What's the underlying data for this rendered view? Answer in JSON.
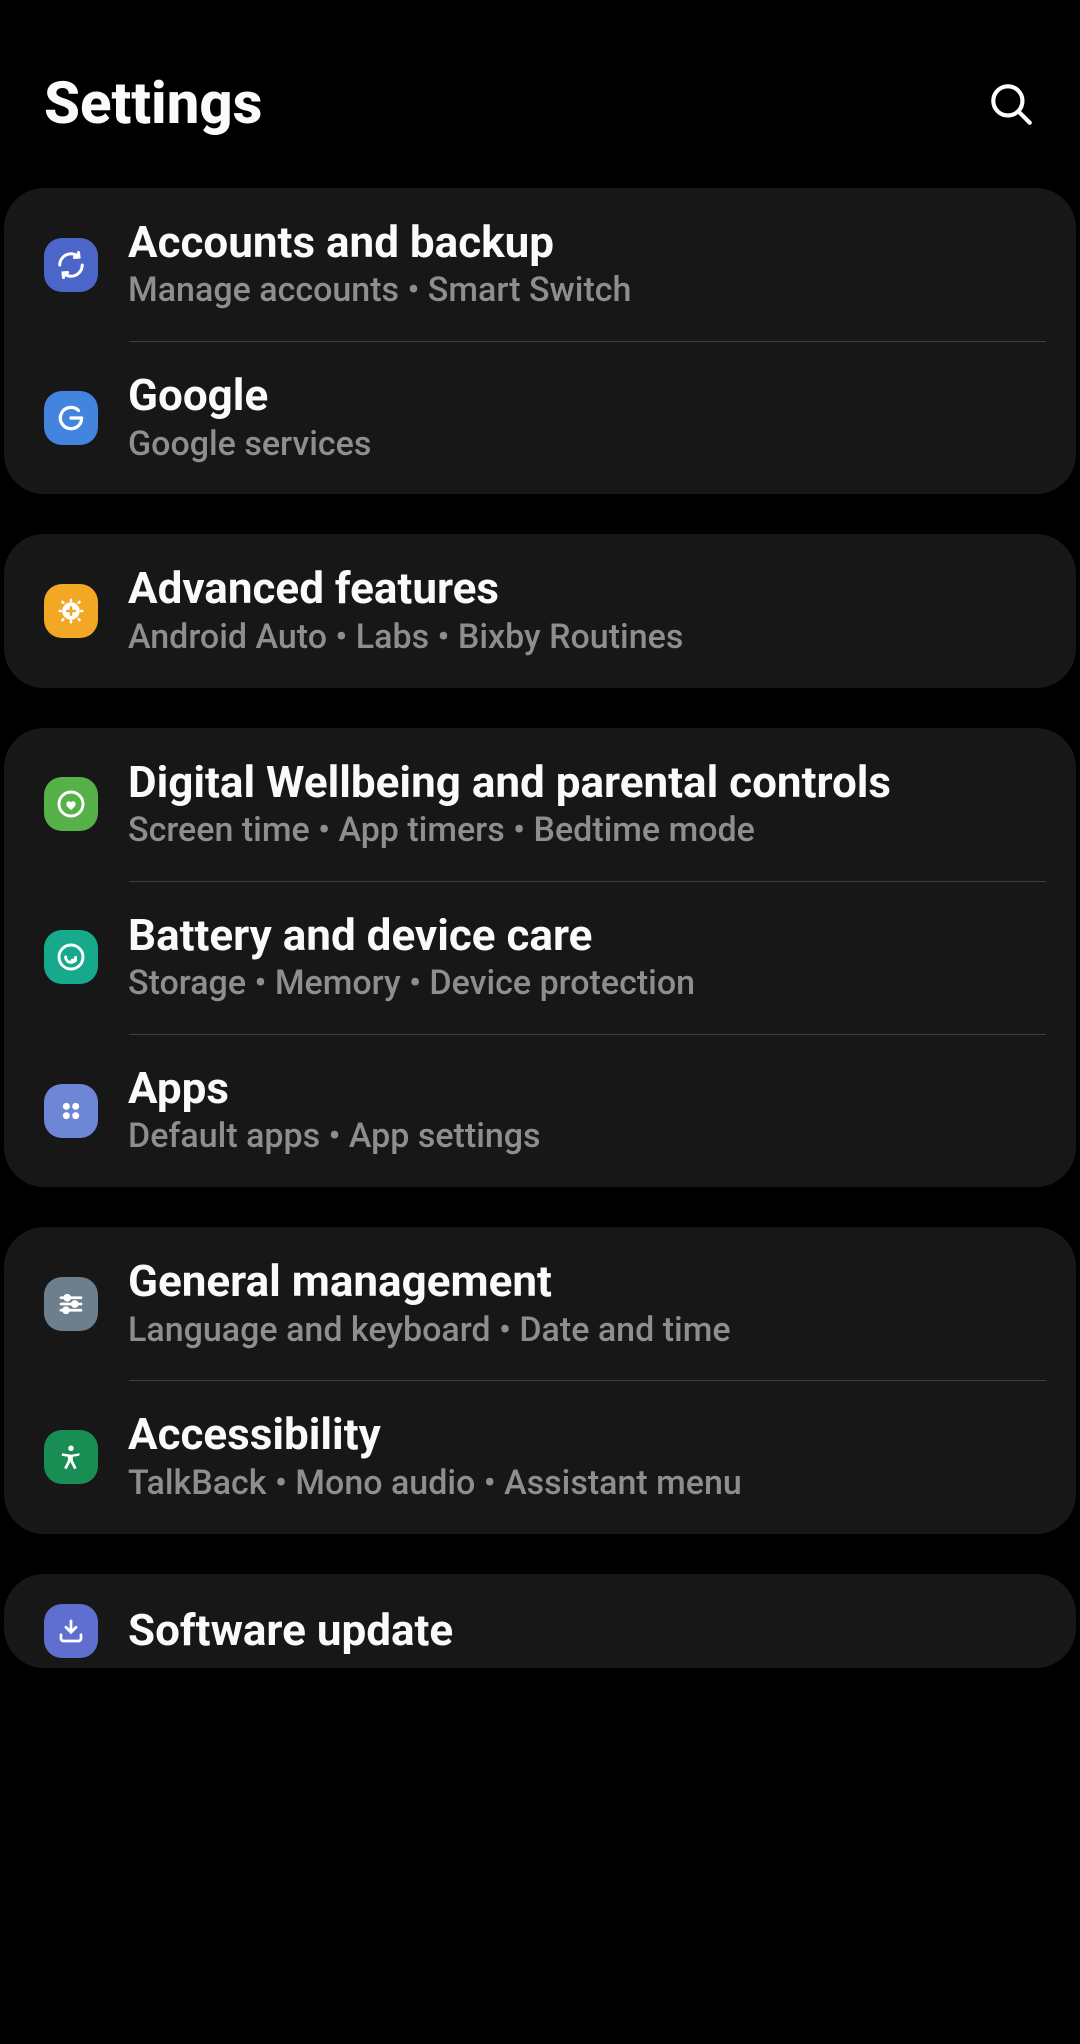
{
  "header": {
    "title": "Settings"
  },
  "groups": [
    {
      "items": [
        {
          "id": "accounts",
          "title": "Accounts and backup",
          "sub": "Manage accounts  •  Smart Switch",
          "icon": "sync-icon",
          "bg": "#4b66c8"
        },
        {
          "id": "google",
          "title": "Google",
          "sub": "Google services",
          "icon": "google-icon",
          "bg": "#4384de"
        }
      ]
    },
    {
      "items": [
        {
          "id": "advanced",
          "title": "Advanced features",
          "sub": "Android Auto  •  Labs  •  Bixby Routines",
          "icon": "plus-gear-icon",
          "bg": "#f2a725"
        }
      ]
    },
    {
      "items": [
        {
          "id": "wellbeing",
          "title": "Digital Wellbeing and parental controls",
          "sub": "Screen time  •  App timers  •  Bedtime mode",
          "icon": "wellbeing-icon",
          "bg": "#55b148"
        },
        {
          "id": "battery",
          "title": "Battery and device care",
          "sub": "Storage  •  Memory  •  Device protection",
          "icon": "care-icon",
          "bg": "#17a98c"
        },
        {
          "id": "apps",
          "title": "Apps",
          "sub": "Default apps  •  App settings",
          "icon": "apps-icon",
          "bg": "#6e86d6"
        }
      ]
    },
    {
      "items": [
        {
          "id": "general",
          "title": "General management",
          "sub": "Language and keyboard  •  Date and time",
          "icon": "sliders-icon",
          "bg": "#6d7e8c"
        },
        {
          "id": "accessibility",
          "title": "Accessibility",
          "sub": "TalkBack  •  Mono audio  •  Assistant menu",
          "icon": "accessibility-icon",
          "bg": "#188d54"
        }
      ]
    },
    {
      "items": [
        {
          "id": "software",
          "title": "Software update",
          "sub": "",
          "icon": "update-icon",
          "bg": "#5f6fcf"
        }
      ]
    }
  ]
}
